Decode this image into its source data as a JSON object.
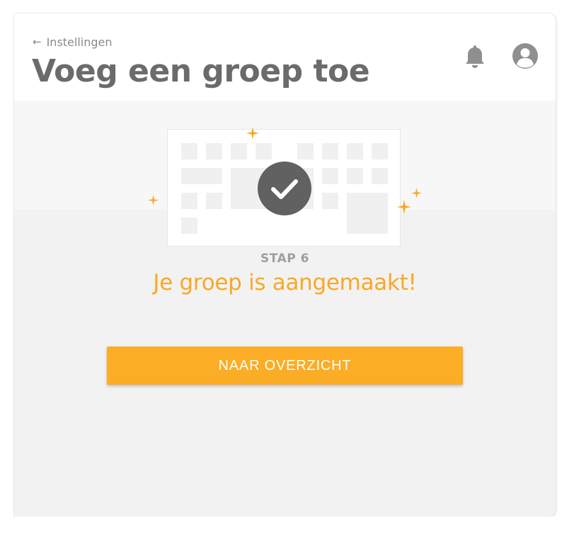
{
  "header": {
    "back_label": "Instellingen",
    "title": "Voeg een groep toe",
    "icons": [
      "arrow-left-icon",
      "bell-icon",
      "user-avatar-icon"
    ]
  },
  "illustration": {
    "icons": [
      "checkmark-icon",
      "sparkle-icon"
    ],
    "colors": {
      "check_bg": "#616161",
      "sparkle": "#f9a825",
      "cell": "#f0f0f0"
    }
  },
  "step": {
    "label": "STAP 6",
    "message": "Je groep is aangemaakt!"
  },
  "actions": {
    "overview_button": "NAAR OVERZICHT"
  },
  "colors": {
    "accent": "#fbad25",
    "title": "#6b6b6b",
    "muted": "#9e9e9e",
    "background": "#f2f2f2"
  }
}
